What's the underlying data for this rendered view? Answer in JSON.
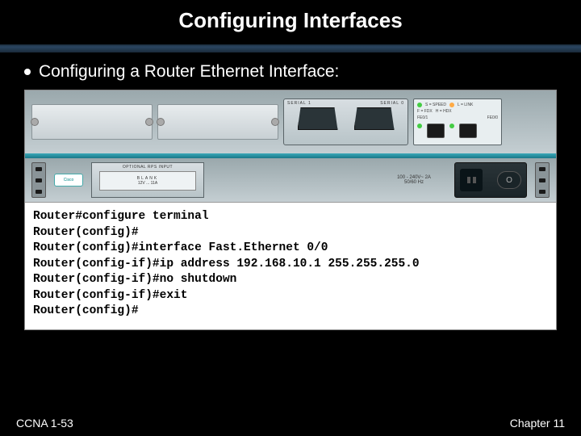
{
  "slide": {
    "title": "Configuring Interfaces",
    "bullet": "Configuring a Router Ethernet Interface:"
  },
  "router": {
    "serial_left_label": "SERIAL 1",
    "serial_right_label": "SERIAL 0",
    "status_s_label": "S = SPEED",
    "status_l_label": "L = LINK",
    "status_fe00": "FE0/0",
    "status_fe01": "FE0/1",
    "status_f": "F = FDX",
    "status_h": "H = HDX",
    "cisco": "Cisco",
    "rps_label": "OPTIONAL RPS INPUT",
    "rps_plate": "BLANK",
    "rps_amp": "12V ... 11A",
    "power_spec_line1": "100 - 240V~ 2A",
    "power_spec_line2": "50/60 Hz"
  },
  "terminal": {
    "lines": [
      "Router#configure terminal",
      "Router(config)#",
      "Router(config)#interface Fast.Ethernet 0/0",
      "Router(config-if)#ip address 192.168.10.1 255.255.255.0",
      "Router(config-if)#no shutdown",
      "Router(config-if)#exit",
      "Router(config)#"
    ]
  },
  "footer": {
    "left": "CCNA 1-53",
    "right": "Chapter 11"
  }
}
